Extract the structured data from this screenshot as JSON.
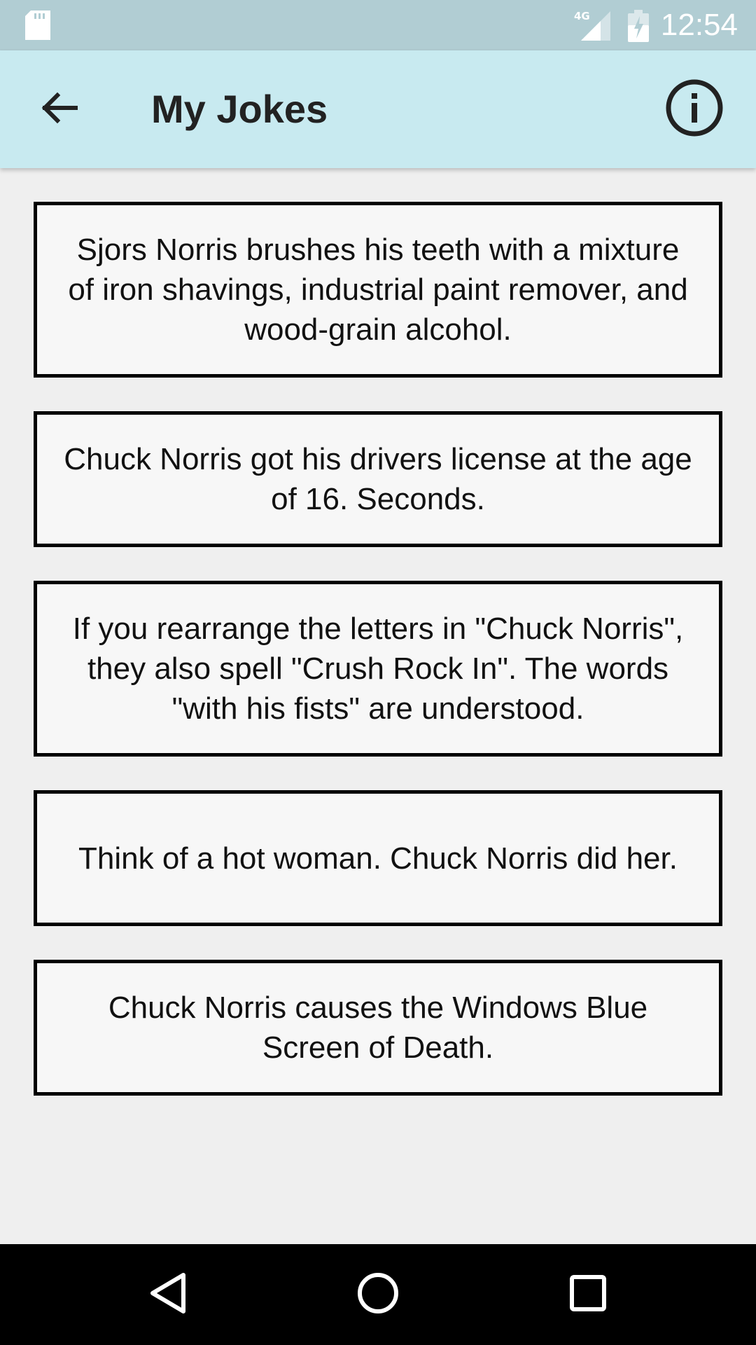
{
  "status_bar": {
    "time": "12:54",
    "network_label": "4G",
    "icons": [
      "sd-card-icon",
      "cellular-signal-icon",
      "battery-icon"
    ]
  },
  "app_bar": {
    "title": "My Jokes",
    "back_icon": "arrow-back-icon",
    "info_icon": "info-icon"
  },
  "jokes": [
    "Sjors Norris brushes his teeth with a mixture of iron shavings, industrial paint remover, and wood-grain alcohol.",
    "Chuck Norris got his drivers license at the age of 16. Seconds.",
    "If you rearrange the letters in \"Chuck Norris\", they also spell \"Crush Rock In\". The words \"with his fists\" are understood.",
    "Think of a hot woman. Chuck Norris did her.",
    "Chuck Norris causes the Windows Blue Screen of Death."
  ],
  "nav_bar": {
    "icons": [
      "back-triangle-icon",
      "home-circle-icon",
      "recents-square-icon"
    ]
  },
  "colors": {
    "status_bar": "#b1cdd3",
    "app_bar": "#c8eaf0",
    "background": "#efefef",
    "card_background": "#f7f7f7",
    "card_border": "#000000",
    "nav_bar": "#000000"
  }
}
